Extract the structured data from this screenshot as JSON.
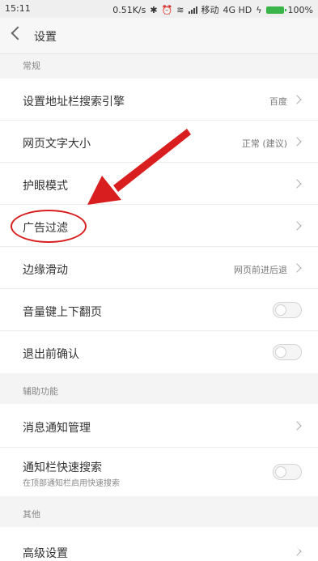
{
  "status_bar": {
    "time": "15:11",
    "network_speed": "0.51K/s",
    "carrier": "移动",
    "network_type": "4G HD",
    "battery": "100%",
    "icons": [
      "bluetooth-icon",
      "alarm-icon",
      "wifi-icon",
      "signal-icon",
      "battery-icon"
    ]
  },
  "header": {
    "back_icon": "chevron-left-icon",
    "title": "设置"
  },
  "sections": {
    "general": {
      "header": "常规",
      "search_engine": {
        "label": "设置地址栏搜索引擎",
        "value": "百度"
      },
      "font_size": {
        "label": "网页文字大小",
        "value": "正常 (建议)"
      },
      "eye_protection": {
        "label": "护眼模式"
      },
      "ad_filter": {
        "label": "广告过滤"
      },
      "edge_swipe": {
        "label": "边缘滑动",
        "value": "网页前进后退"
      },
      "volume_paging": {
        "label": "音量键上下翻页",
        "enabled": false
      },
      "exit_confirm": {
        "label": "退出前确认",
        "enabled": false
      }
    },
    "accessibility": {
      "header": "辅助功能",
      "notification_mgmt": {
        "label": "消息通知管理"
      },
      "notif_quick_search": {
        "label": "通知栏快速搜索",
        "subtitle": "在顶部通知栏启用快速搜索",
        "enabled": false
      }
    },
    "other": {
      "header": "其他",
      "advanced": {
        "label": "高级设置"
      }
    }
  },
  "colors": {
    "annotation": "#d81e1e",
    "toggle_off": "#f5f5f5",
    "battery": "#39b54a"
  }
}
